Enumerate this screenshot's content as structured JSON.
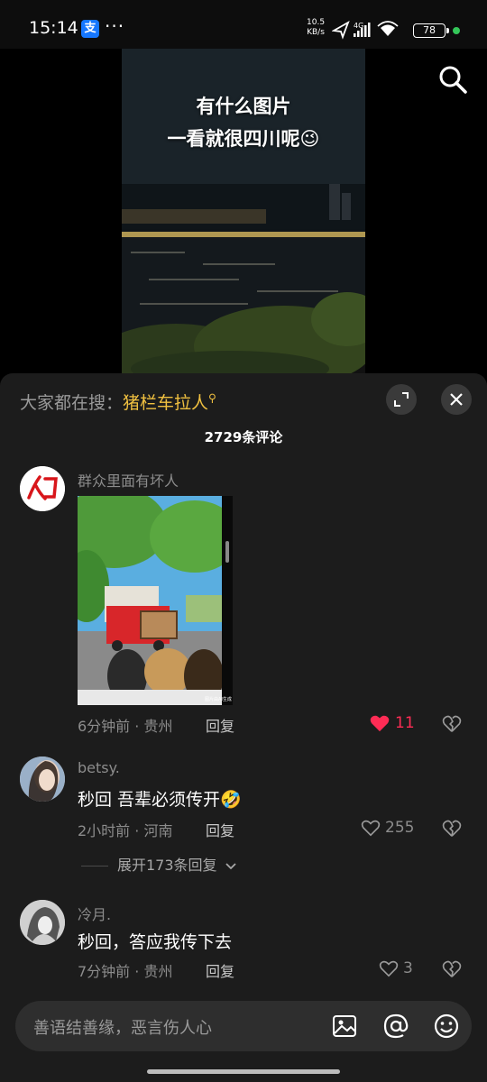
{
  "status_bar": {
    "time": "15:14",
    "alipay_glyph": "支",
    "more": "···",
    "speed_value": "10.5",
    "speed_unit": "KB/s",
    "network": "4G",
    "battery": "78"
  },
  "video": {
    "caption_line1": "有什么图片",
    "caption_line2": "一看就很四川呢😉"
  },
  "comments_panel": {
    "hot_search_label": "大家都在搜：",
    "hot_search_term": "猪栏车拉人",
    "count_label": "2729条评论",
    "expand_label": "展开173条回复"
  },
  "comments": [
    {
      "username": "群众里面有坏人",
      "text": "",
      "image_caption": "图片由AI生成",
      "time": "6分钟前",
      "location": "贵州",
      "reply_label": "回复",
      "likes": "11",
      "liked": true
    },
    {
      "username": "betsy.",
      "text": "秒回 吾辈必须传开🤣",
      "time": "2小时前",
      "location": "河南",
      "reply_label": "回复",
      "likes": "255",
      "liked": false
    },
    {
      "username": "冷月.",
      "text": "秒回，答应我传下去",
      "time": "7分钟前",
      "location": "贵州",
      "reply_label": "回复",
      "likes": "3",
      "liked": false
    }
  ],
  "input": {
    "placeholder": "善语结善缘，恶言伤人心"
  },
  "colors": {
    "sheet_bg": "#1c1c1c",
    "accent_yellow": "#f0c040",
    "like_red": "#fe2c55"
  },
  "icons": [
    "search-icon",
    "expand-icon",
    "close-icon",
    "heart-icon",
    "dislike-icon",
    "image-icon",
    "mention-icon",
    "emoji-icon"
  ]
}
